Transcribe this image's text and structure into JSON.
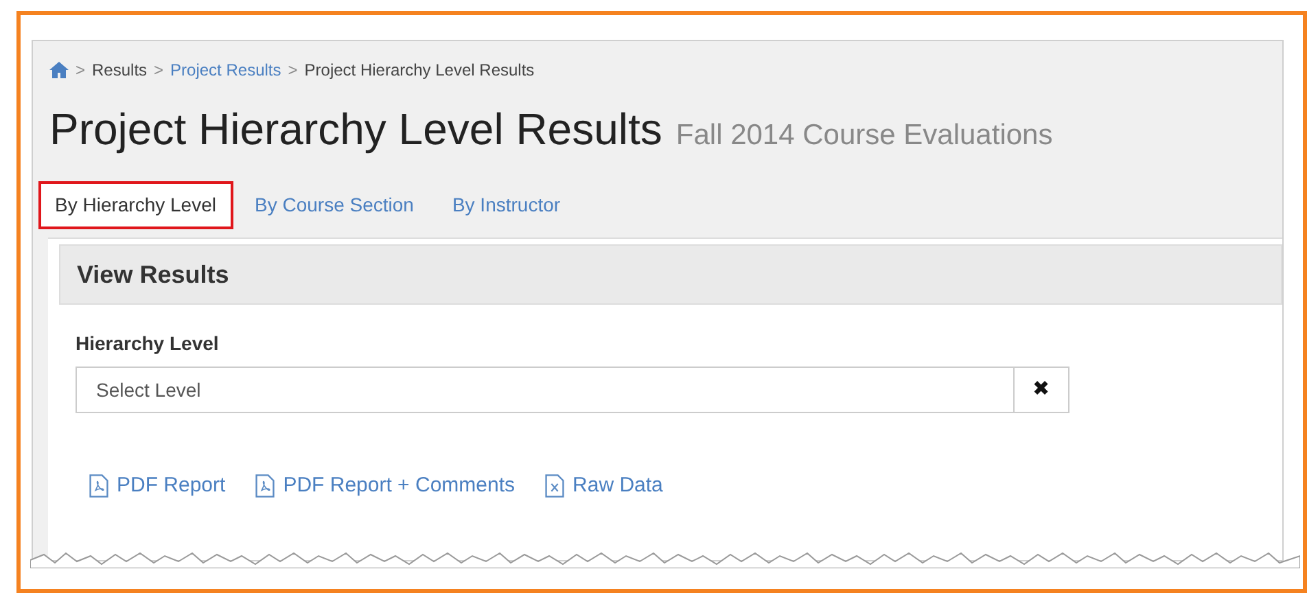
{
  "breadcrumb": {
    "separator": ">",
    "items": [
      {
        "kind": "home"
      },
      {
        "kind": "text",
        "label": "Results"
      },
      {
        "kind": "link",
        "label": "Project Results"
      },
      {
        "kind": "text",
        "label": "Project Hierarchy Level Results"
      }
    ]
  },
  "title": "Project Hierarchy Level Results",
  "subtitle": "Fall 2014 Course Evaluations",
  "tabs": [
    {
      "label": "By Hierarchy Level",
      "selected": true
    },
    {
      "label": "By Course Section",
      "selected": false
    },
    {
      "label": "By Instructor",
      "selected": false
    }
  ],
  "panel": {
    "title": "View Results",
    "field_label": "Hierarchy Level",
    "field_value": "Select Level",
    "clear_button": "✖"
  },
  "links": [
    {
      "kind": "pdf",
      "label": "PDF Report"
    },
    {
      "kind": "pdf",
      "label": "PDF Report + Comments"
    },
    {
      "kind": "excel",
      "label": "Raw Data"
    }
  ]
}
